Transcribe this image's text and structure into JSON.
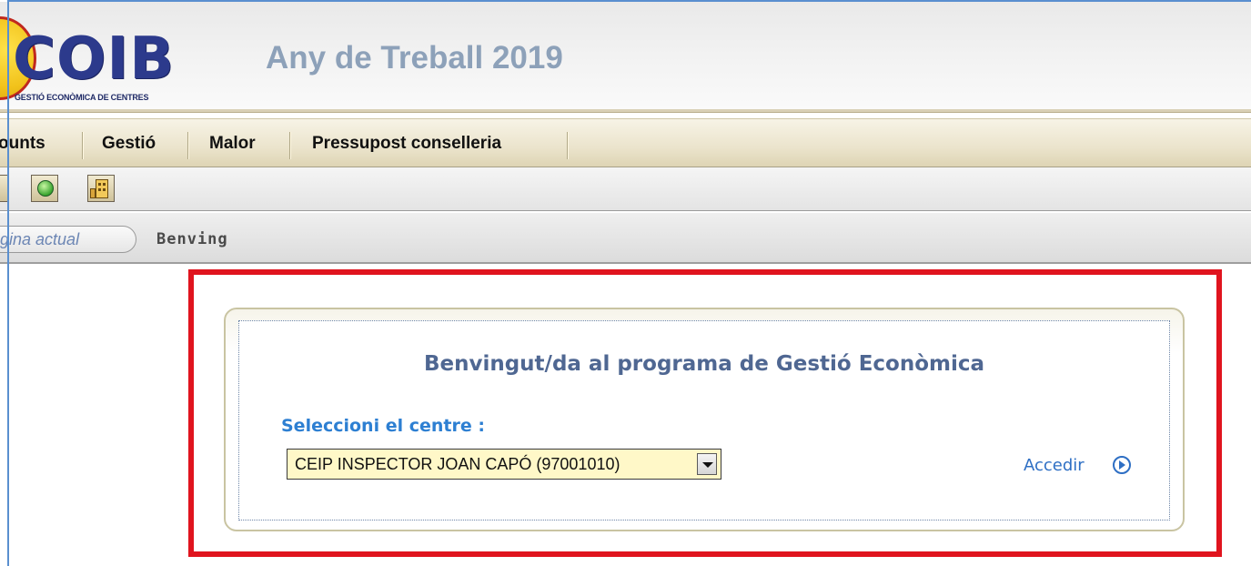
{
  "header": {
    "logo_text": "COIB",
    "logo_subtitle": "GESTIÓ ECONÒMICA DE CENTRES",
    "title": "Any de Treball 2019"
  },
  "menu": {
    "items": [
      {
        "label": "ounts"
      },
      {
        "label": "Gestió"
      },
      {
        "label": "Malor"
      },
      {
        "label": "Pressupost conselleria"
      }
    ]
  },
  "toolbar": {
    "buttons": [
      {
        "icon": "toolbar-button-icon"
      },
      {
        "icon": "globe-refresh-icon"
      },
      {
        "icon": "building-icon"
      }
    ]
  },
  "breadcrumb": {
    "current_label": "gina actual",
    "page": "Benving"
  },
  "welcome": {
    "title": "Benvingut/da al programa de Gestió Econòmica",
    "select_label": "Seleccioni el centre :",
    "selected_centre": "CEIP INSPECTOR JOAN CAPÓ (97001010)",
    "access_link": "Accedir"
  },
  "colors": {
    "highlight_border": "#e0141e",
    "title_text": "#4f6792",
    "label_blue": "#2d7fd2",
    "select_bg": "#fff8c8",
    "link_blue": "#2e6fc4"
  }
}
